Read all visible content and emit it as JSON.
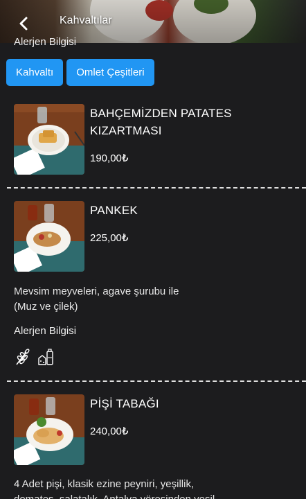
{
  "header": {
    "title": "Kahvaltılar",
    "back_icon": "chevron-left-icon"
  },
  "cut_off_text": "Alerjen Bilgisi",
  "categories": [
    {
      "label": "Kahvaltı"
    },
    {
      "label": "Omlet Çeşitleri"
    }
  ],
  "accent_color": "#2196f3",
  "items": [
    {
      "name_line1": "BAHÇEMİZDEN PATATES",
      "name_line2": "KIZARTMASI",
      "price": "190,00₺"
    },
    {
      "name_line1": "PANKEK",
      "price": "225,00₺",
      "description_line1": "Mevsim meyveleri, agave şurubu ile",
      "description_line2": "(Muz ve çilek)",
      "allergen_title": "Alerjen Bilgisi",
      "allergen_icons": [
        "wheat-icon",
        "dairy-icon"
      ]
    },
    {
      "name_line1": "PİŞİ TABAĞI",
      "price": "240,00₺",
      "description_line1": "4 Adet pişi, klasik ezine peyniri, yeşillik,",
      "description_line2": "domates, salatalık, Antalya yöresinden yeşil"
    }
  ]
}
